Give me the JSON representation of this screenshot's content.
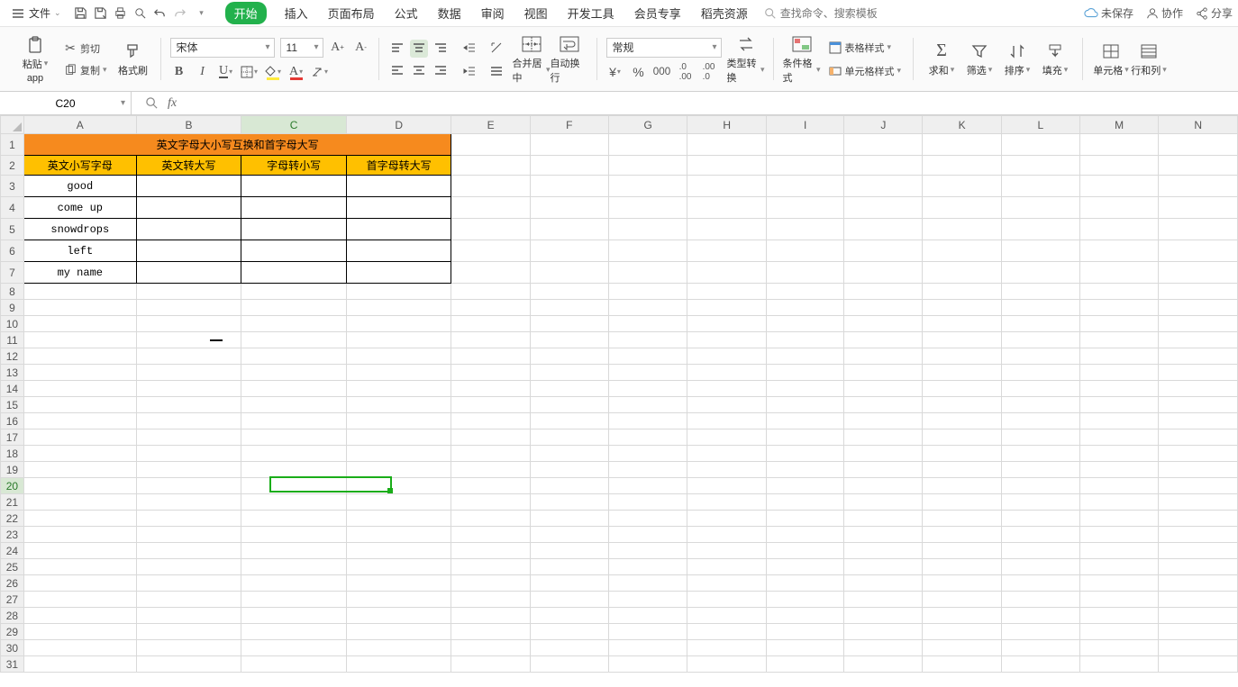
{
  "menubar": {
    "file_label": "文件",
    "tabs": [
      "开始",
      "插入",
      "页面布局",
      "公式",
      "数据",
      "审阅",
      "视图",
      "开发工具",
      "会员专享",
      "稻壳资源"
    ],
    "active_tab": 0,
    "search_placeholder": "查找命令、搜索模板"
  },
  "right_actions": {
    "unsaved": "未保存",
    "coop": "协作",
    "share": "分享"
  },
  "ribbon": {
    "paste": "粘贴",
    "cut": "剪切",
    "copy": "复制",
    "format_painter": "格式刷",
    "font_name": "宋体",
    "font_size": "11",
    "merge_center": "合并居中",
    "wrap_text": "自动换行",
    "number_format": "常规",
    "type_convert": "类型转换",
    "cond_format": "条件格式",
    "table_style": "表格样式",
    "cell_style": "单元格样式",
    "sum": "求和",
    "filter": "筛选",
    "sort": "排序",
    "fill": "填充",
    "cells": "单元格",
    "rows_cols": "行和列"
  },
  "name_box": "C20",
  "columns": [
    "A",
    "B",
    "C",
    "D",
    "E",
    "F",
    "G",
    "H",
    "I",
    "J",
    "K",
    "L",
    "M",
    "N"
  ],
  "row_count": 31,
  "active_col_index": 2,
  "active_row": 20,
  "table": {
    "title": "英文字母大小写互换和首字母大写",
    "headers": [
      "英文小写字母",
      "英文转大写",
      "字母转小写",
      "首字母转大写"
    ],
    "rows": [
      [
        "good",
        "",
        "",
        ""
      ],
      [
        "come up",
        "",
        "",
        ""
      ],
      [
        "snowdrops",
        "",
        "",
        ""
      ],
      [
        "left",
        "",
        "",
        ""
      ],
      [
        "my name",
        "",
        "",
        ""
      ]
    ]
  }
}
